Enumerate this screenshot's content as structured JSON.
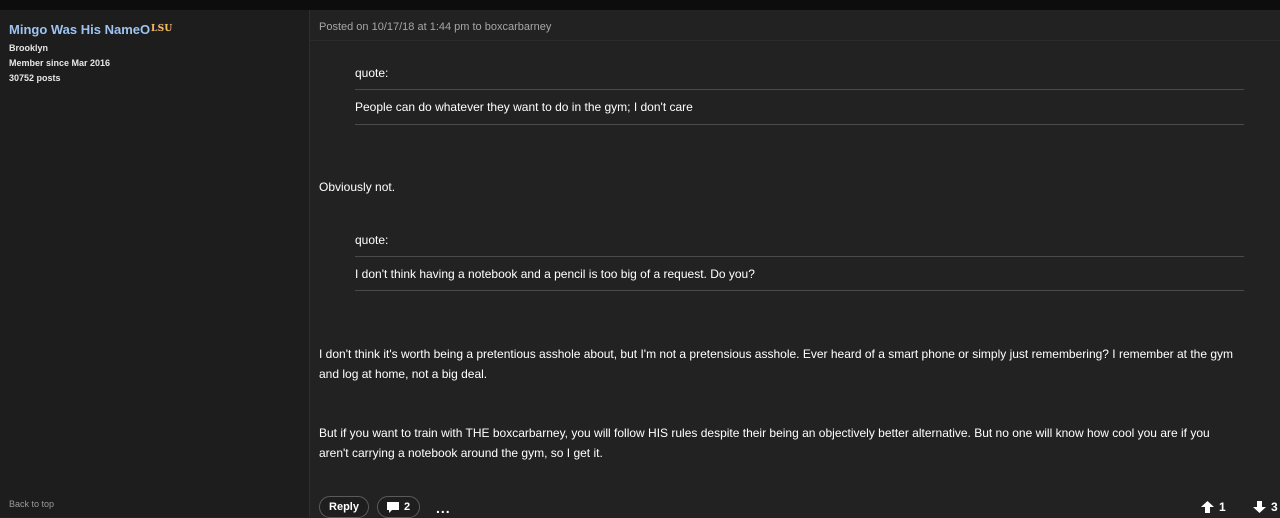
{
  "author": {
    "name": "Mingo Was His NameO",
    "team_badge": "LSU",
    "location": "Brooklyn",
    "member_since": "Member since Mar 2016",
    "posts": "30752 posts"
  },
  "sidebar": {
    "back_to_top": "Back to top"
  },
  "post": {
    "header": "Posted on 10/17/18 at 1:44 pm to boxcarbarney",
    "quote1": {
      "label": "quote:",
      "text": "People can do whatever they want to do in the gym; I don't care"
    },
    "reply1": "Obviously not.",
    "quote2": {
      "label": "quote:",
      "text": "I don't think having a notebook and a pencil is too big of a request. Do you?"
    },
    "paragraph1_line1": "I don't think it's worth being a pretentious asshole about, but I'm not a pretensious asshole. Ever heard of a smart phone or simply just remembering? I remember at the gym",
    "paragraph1_line2": "and log at home, not a big deal.",
    "paragraph2_line1": "But if you want to train with THE boxcarbarney, you will follow HIS rules despite their being an objectively better alternative. But no one will know how cool you are if you",
    "paragraph2_line2": "aren't carrying a notebook around the gym, so I get it."
  },
  "actions": {
    "reply_label": "Reply",
    "comments_count": "2",
    "more_label": "...",
    "upvotes": "1",
    "downvotes": "3"
  },
  "colors": {
    "username": "#9ec3f2",
    "background": "#222222",
    "sidebar": "#1d1d1d"
  },
  "icons": [
    "comment-icon",
    "upvote-arrow-icon",
    "downvote-arrow-icon"
  ]
}
